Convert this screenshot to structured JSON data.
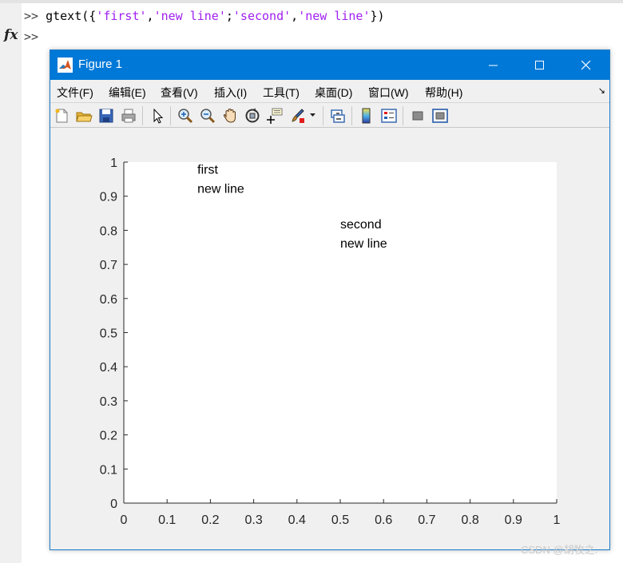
{
  "command_window": {
    "history": [
      {
        "prompt": ">>",
        "code_parts": [
          {
            "text": " gtext({",
            "type": "code"
          },
          {
            "text": "'first'",
            "type": "str"
          },
          {
            "text": ",",
            "type": "code"
          },
          {
            "text": "'new line'",
            "type": "str"
          },
          {
            "text": ";",
            "type": "code"
          },
          {
            "text": "'second'",
            "type": "str"
          },
          {
            "text": ",",
            "type": "code"
          },
          {
            "text": "'new line'",
            "type": "str"
          },
          {
            "text": "})",
            "type": "code"
          }
        ]
      },
      {
        "prompt": ">>",
        "code_parts": []
      }
    ],
    "fx_label": "fx"
  },
  "figure": {
    "title": "Figure 1",
    "menu": [
      {
        "label": "文件(F)"
      },
      {
        "label": "编辑(E)"
      },
      {
        "label": "查看(V)"
      },
      {
        "label": "插入(I)"
      },
      {
        "label": "工具(T)"
      },
      {
        "label": "桌面(D)"
      },
      {
        "label": "窗口(W)"
      },
      {
        "label": "帮助(H)"
      }
    ],
    "menu_more_icon": "dock-arrow-icon",
    "toolbar_icons": [
      "new-figure-icon",
      "open-file-icon",
      "save-icon",
      "print-icon",
      "select-arrow-icon",
      "zoom-in-icon",
      "zoom-out-icon",
      "pan-hand-icon",
      "rotate-3d-icon",
      "data-cursor-icon",
      "brush-icon",
      "link-plot-icon",
      "colorbar-icon",
      "legend-icon",
      "hide-plot-tools-icon",
      "show-plot-tools-icon"
    ]
  },
  "chart_data": {
    "type": "scatter",
    "title": "",
    "xlabel": "",
    "ylabel": "",
    "xlim": [
      0,
      1
    ],
    "ylim": [
      0,
      1
    ],
    "xticks": [
      "0",
      "0.1",
      "0.2",
      "0.3",
      "0.4",
      "0.5",
      "0.6",
      "0.7",
      "0.8",
      "0.9",
      "1"
    ],
    "yticks": [
      "0",
      "0.1",
      "0.2",
      "0.3",
      "0.4",
      "0.5",
      "0.6",
      "0.7",
      "0.8",
      "0.9",
      "1"
    ],
    "grid": false,
    "annotations": [
      {
        "x": 0.17,
        "y": 0.98,
        "lines": [
          "first",
          "new line"
        ]
      },
      {
        "x": 0.5,
        "y": 0.82,
        "lines": [
          "second",
          "new line"
        ]
      }
    ]
  },
  "watermark": "CSDN @胡牧之."
}
